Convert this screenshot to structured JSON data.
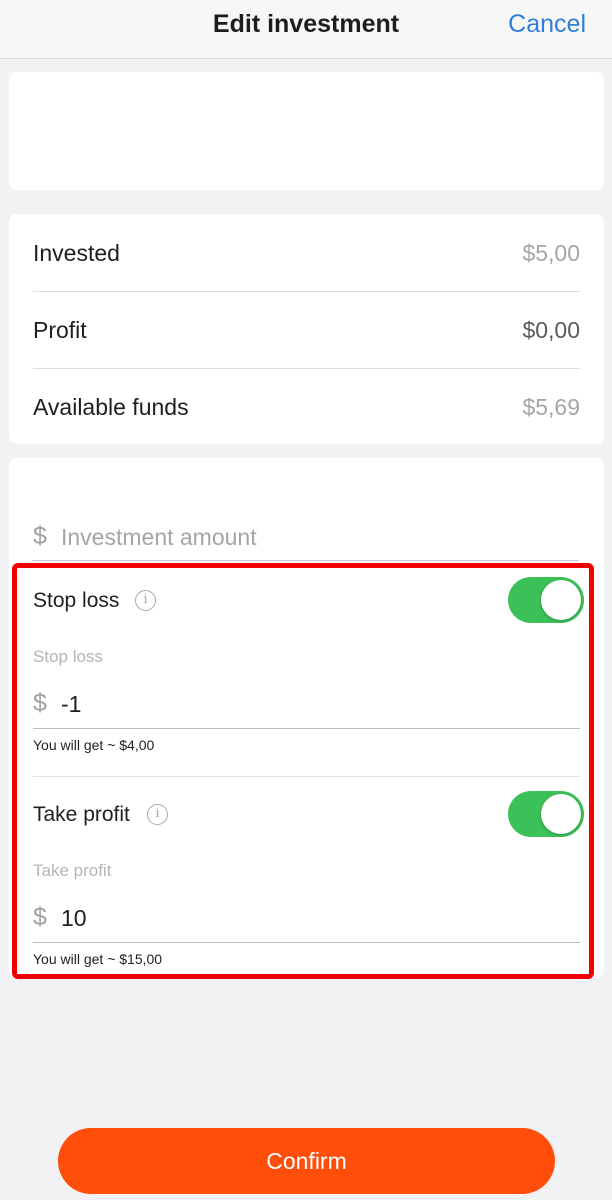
{
  "header": {
    "title": "Edit investment",
    "cancel_label": "Cancel"
  },
  "summary": {
    "rows": [
      {
        "label": "Invested",
        "value": "$5,00"
      },
      {
        "label": "Profit",
        "value": "$0,00"
      },
      {
        "label": "Available funds",
        "value": "$5,69"
      }
    ]
  },
  "form": {
    "currency_symbol": "$",
    "amount_placeholder": "Investment amount",
    "stop_loss": {
      "label": "Stop loss",
      "enabled": true,
      "caption": "Stop loss",
      "value": "-1",
      "hint": "You will get ~ $4,00"
    },
    "take_profit": {
      "label": "Take profit",
      "enabled": true,
      "caption": "Take profit",
      "value": "10",
      "hint": "You will get ~ $15,00"
    },
    "info_icon": "i"
  },
  "confirm_label": "Confirm",
  "colors": {
    "accent": "#ff4d0a",
    "toggle_on": "#3cc158",
    "link": "#2f7fd8",
    "highlight": "#f00000"
  }
}
